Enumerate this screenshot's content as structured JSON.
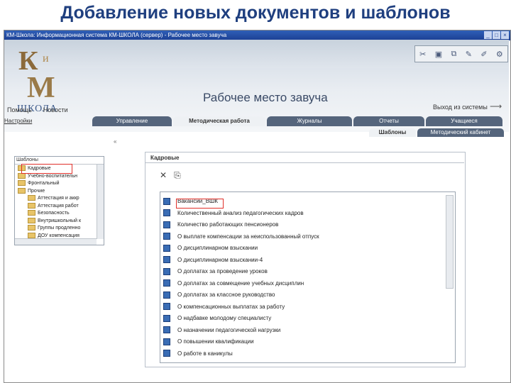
{
  "slide_title": "Добавление новых документов и шаблонов",
  "window_title": "КМ-Школа: Информационная система КМ-ШКОЛА (сервер) - Рабочее место завуча",
  "toolbar": {
    "icons": [
      "scissors-icon",
      "save-icon",
      "copy-icon",
      "edit-icon",
      "pen-icon",
      "settings-icon"
    ]
  },
  "logo": {
    "k": "К",
    "i": "и",
    "m": "М",
    "school": "ШКОЛА"
  },
  "workplace_title": "Рабочее место завуча",
  "exit_link": "Выход из системы",
  "nav": {
    "help": "Помощь",
    "news": "Новости"
  },
  "settings_link": "Настройки",
  "tabs": [
    {
      "label": "Управление",
      "active": false
    },
    {
      "label": "Методическая работа",
      "active": true
    },
    {
      "label": "Журналы",
      "active": false
    },
    {
      "label": "Отчеты",
      "active": false
    },
    {
      "label": "Учащиеся",
      "active": false
    }
  ],
  "subtabs": [
    {
      "label": "Шаблоны",
      "active": true
    },
    {
      "label": "Методический кабинет",
      "active": false
    }
  ],
  "tree": {
    "header": "Шаблоны",
    "items": [
      {
        "label": "Кадровые",
        "indent": 0
      },
      {
        "label": "Учебно-воспитательн",
        "indent": 0
      },
      {
        "label": "Фронтальный",
        "indent": 0
      },
      {
        "label": "Прочие",
        "indent": 0
      },
      {
        "label": "Аттестация и аккр",
        "indent": 1
      },
      {
        "label": "Аттестация работ",
        "indent": 1
      },
      {
        "label": "Безопасность",
        "indent": 1
      },
      {
        "label": "Внутришкольный к",
        "indent": 1
      },
      {
        "label": "Группы продленно",
        "indent": 1
      },
      {
        "label": "ДОУ компенсация",
        "indent": 1
      }
    ]
  },
  "doc_panel": {
    "tab_label": "Кадровые",
    "documents": [
      "Вакансии_ВШК",
      "Количественный анализ педагогических кадров",
      "Количество работающих пенсионеров",
      "О выплате компенсации за неиспользованный отпуск",
      "О дисциплинарном взыскании",
      "О дисциплинарном взыскании-4",
      "О доплатах за проведение уроков",
      "О доплатах за совмещение учебных дисциплин",
      "О доплатах за классное руководство",
      "О компенсационных выплатах за работу",
      "О надбавке молодому специалисту",
      "О назначении педагогической нагрузки",
      "О повышении квалификации",
      "О работе в каникулы"
    ]
  }
}
